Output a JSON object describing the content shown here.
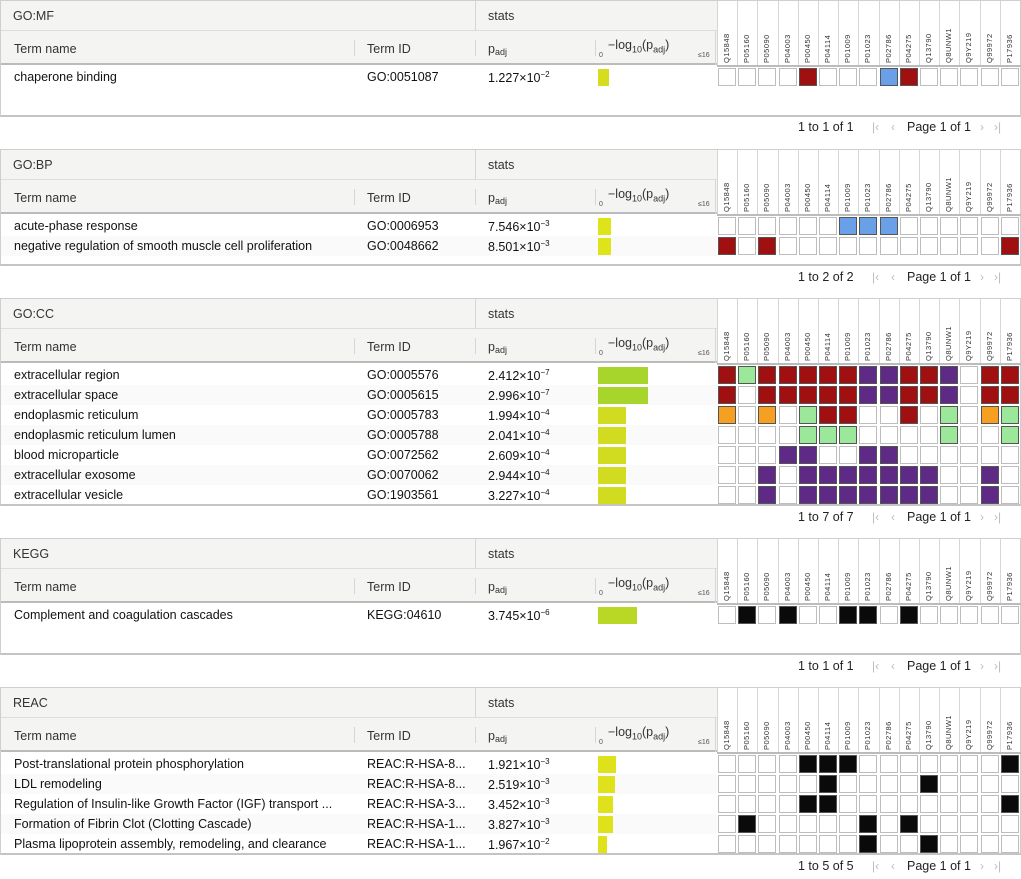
{
  "columns": {
    "term_name": "Term name",
    "term_id": "Term ID",
    "padj": "p",
    "padj_sub": "adj",
    "stats": "stats",
    "log_label_prefix": "−log",
    "log_sub": "10",
    "log_label_mid": "(p",
    "log_label_sub2": "adj",
    "log_label_end": ")",
    "axis_min": "0",
    "axis_max": "≤16"
  },
  "genes": [
    "Q15848",
    "P05160",
    "P05090",
    "P04003",
    "P00450",
    "P04114",
    "P01009",
    "P01023",
    "P02786",
    "P04275",
    "Q13790",
    "Q8UNW1",
    "Q9Y219",
    "Q99972",
    "P17936"
  ],
  "colors": {
    "R": "#a01010",
    "B": "#6aa0e8",
    "G": "#9be89b",
    "O": "#f5a020",
    "P": "#5e2a86",
    "K": "#0a0a0a"
  },
  "sections": [
    {
      "source": "GO:MF",
      "pager": "1 to 1 of 1",
      "page": "Page 1 of 1",
      "rows": [
        {
          "name": "chaperone binding",
          "id": "GO:0051087",
          "p": "1.227×10",
          "e": "−2",
          "bar": 0.1,
          "bc": "#d8dc1e",
          "cells": "....R...BR....."
        }
      ]
    },
    {
      "source": "GO:BP",
      "pager": "1 to 2 of 2",
      "page": "Page 1 of 1",
      "rows": [
        {
          "name": "acute-phase response",
          "id": "GO:0006953",
          "p": "7.546×10",
          "e": "−3",
          "bar": 0.12,
          "bc": "#dee31a",
          "cells": "......BBB......"
        },
        {
          "name": "negative regulation of smooth muscle cell proliferation",
          "id": "GO:0048662",
          "p": "8.501×10",
          "e": "−3",
          "bar": 0.12,
          "bc": "#dee31a",
          "cells": "R.R...........R"
        }
      ]
    },
    {
      "source": "GO:CC",
      "pager": "1 to 7 of 7",
      "page": "Page 1 of 1",
      "rows": [
        {
          "name": "extracellular region",
          "id": "GO:0005576",
          "p": "2.412×10",
          "e": "−7",
          "bar": 0.45,
          "bc": "#a8d52b",
          "cells": "RGRRRRRPPRRP.RR"
        },
        {
          "name": "extracellular space",
          "id": "GO:0005615",
          "p": "2.996×10",
          "e": "−7",
          "bar": 0.45,
          "bc": "#a8d52b",
          "cells": "R.RRRRRPPRRP.RR"
        },
        {
          "name": "endoplasmic reticulum",
          "id": "GO:0005783",
          "p": "1.994×10",
          "e": "−4",
          "bar": 0.25,
          "bc": "#d1dc20",
          "cells": "O.O.GRR..R.G.OG"
        },
        {
          "name": "endoplasmic reticulum lumen",
          "id": "GO:0005788",
          "p": "2.041×10",
          "e": "−4",
          "bar": 0.25,
          "bc": "#d1dc20",
          "cells": "....GGG....G..G"
        },
        {
          "name": "blood microparticle",
          "id": "GO:0072562",
          "p": "2.609×10",
          "e": "−4",
          "bar": 0.25,
          "bc": "#d1dc20",
          "cells": "...PP..PP......"
        },
        {
          "name": "extracellular exosome",
          "id": "GO:0070062",
          "p": "2.944×10",
          "e": "−4",
          "bar": 0.25,
          "bc": "#d1dc20",
          "cells": "..P.PPPPPPP..P."
        },
        {
          "name": "extracellular vesicle",
          "id": "GO:1903561",
          "p": "3.227×10",
          "e": "−4",
          "bar": 0.25,
          "bc": "#d1dc20",
          "cells": "..P.PPPPPPP..P."
        }
      ]
    },
    {
      "source": "KEGG",
      "pager": "1 to 1 of 1",
      "page": "Page 1 of 1",
      "rows": [
        {
          "name": "Complement and coagulation cascades",
          "id": "KEGG:04610",
          "p": "3.745×10",
          "e": "−6",
          "bar": 0.35,
          "bc": "#b8d825",
          "cells": ".K.K..KK.K....."
        }
      ]
    },
    {
      "source": "REAC",
      "pager": "1 to 5 of 5",
      "page": "Page 1 of 1",
      "rows": [
        {
          "name": "Post-translational protein phosphorylation",
          "id": "REAC:R-HSA-8...",
          "p": "1.921×10",
          "e": "−3",
          "bar": 0.16,
          "bc": "#dfe21a",
          "cells": "....KKK.......K"
        },
        {
          "name": "LDL remodeling",
          "id": "REAC:R-HSA-8...",
          "p": "2.519×10",
          "e": "−3",
          "bar": 0.15,
          "bc": "#dfe21a",
          "cells": ".....K....K...."
        },
        {
          "name": "Regulation of Insulin-like Growth Factor (IGF) transport ...",
          "id": "REAC:R-HSA-3...",
          "p": "3.452×10",
          "e": "−3",
          "bar": 0.14,
          "bc": "#dfe21a",
          "cells": "....KK........K"
        },
        {
          "name": "Formation of Fibrin Clot (Clotting Cascade)",
          "id": "REAC:R-HSA-1...",
          "p": "3.827×10",
          "e": "−3",
          "bar": 0.14,
          "bc": "#dfe21a",
          "cells": ".K.....K.K....."
        },
        {
          "name": "Plasma lipoprotein assembly, remodeling, and clearance",
          "id": "REAC:R-HSA-1...",
          "p": "1.967×10",
          "e": "−2",
          "bar": 0.08,
          "bc": "#dfe21a",
          "cells": ".......K..K...."
        }
      ]
    }
  ]
}
